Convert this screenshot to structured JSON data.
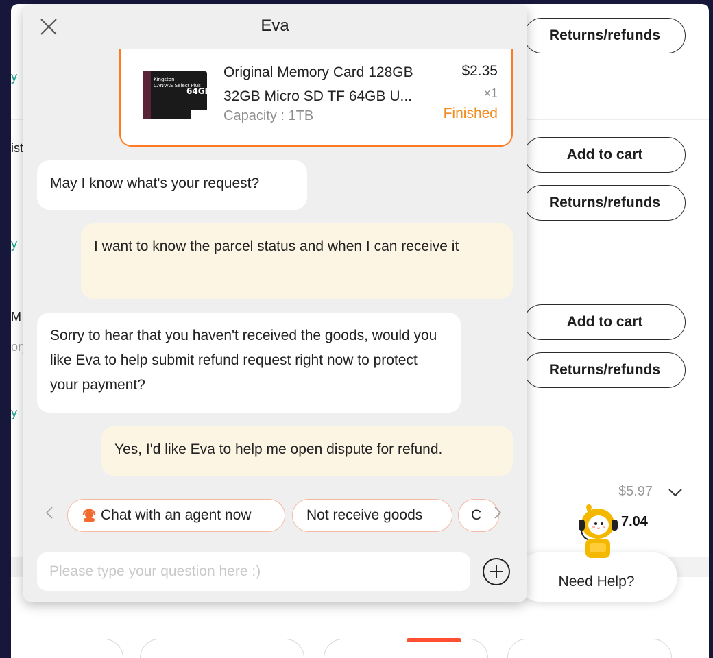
{
  "background": {
    "left_fragments": [
      {
        "text": "y",
        "color": "teal"
      },
      {
        "text": "ist",
        "color": "dark"
      },
      {
        "text": "y",
        "color": "teal"
      },
      {
        "text": "M",
        "color": "dark"
      },
      {
        "text": "ory",
        "color": "grey"
      },
      {
        "text": "y",
        "color": "teal"
      }
    ],
    "buttons": {
      "returns_refunds_1": "Returns/refunds",
      "add_to_cart_1": "Add to cart",
      "returns_refunds_2": "Returns/refunds",
      "add_to_cart_2": "Add to cart",
      "returns_refunds_3": "Returns/refunds"
    },
    "price_original": "$5.97",
    "price_total": "7.04"
  },
  "help_widget": {
    "label": "Need Help?"
  },
  "chat": {
    "title": "Eva",
    "order": {
      "name": "Original Memory Card 128GB 32GB Micro SD TF 64GB U...",
      "variant": "Capacity : 1TB",
      "price": "$2.35",
      "quantity": "×1",
      "status": "Finished",
      "image_text": [
        "Kingston",
        "CANVAS Select Plus",
        "64GB"
      ]
    },
    "messages": [
      {
        "from": "bot",
        "text": "May I know what's your request?"
      },
      {
        "from": "user",
        "text": "I want to know the parcel status and when I can receive it"
      },
      {
        "from": "bot",
        "text": "Sorry to hear that you haven't received the goods, would you like Eva to help submit refund request right now to protect your payment?"
      },
      {
        "from": "user",
        "text": "Yes, I'd like Eva to help me open dispute for refund."
      }
    ],
    "quick_replies": [
      "Chat with an agent now",
      "Not receive goods",
      "C"
    ],
    "input_placeholder": "Please type your question here :)"
  },
  "colors": {
    "accent_orange": "#ff7a20",
    "status_orange": "#f28a1c",
    "teal": "#14a085",
    "user_bubble": "#fdf5e4",
    "panel_bg": "#efefef"
  }
}
